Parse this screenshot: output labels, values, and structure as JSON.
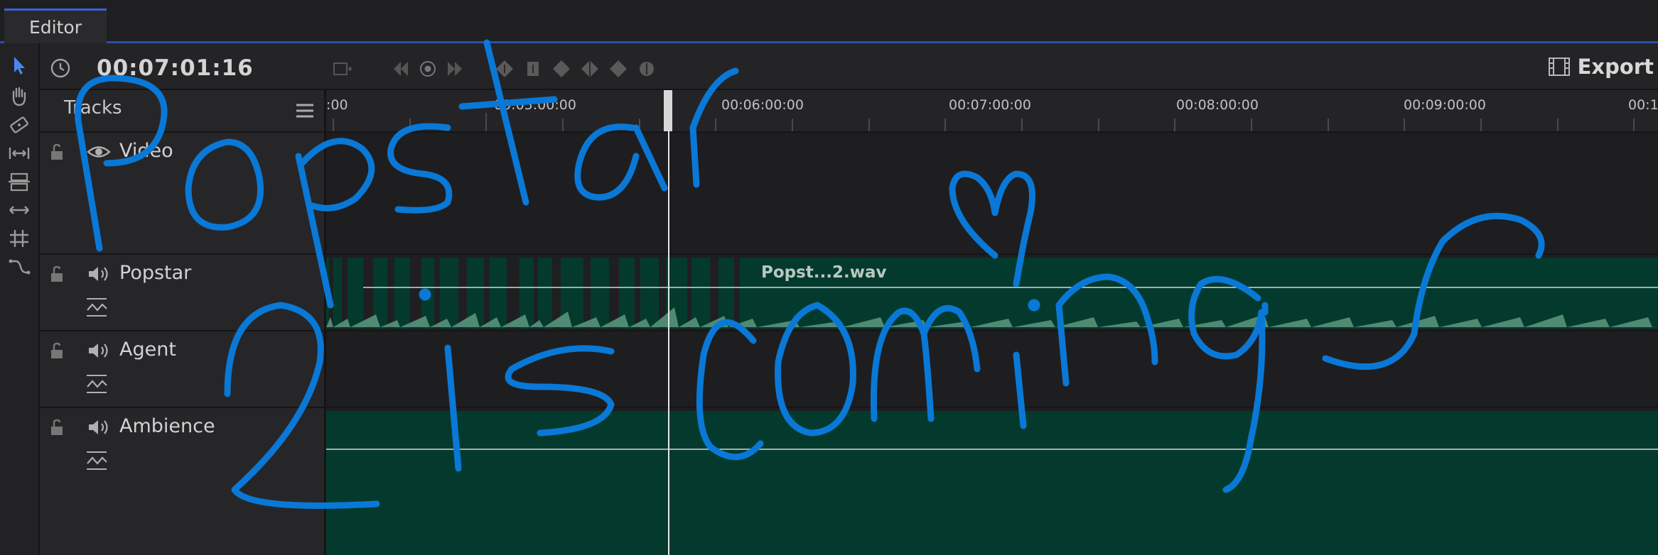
{
  "tabs": [
    {
      "label": "Editor",
      "active": true
    }
  ],
  "tools": [
    "select-arrow-icon",
    "hand-icon",
    "razor-icon",
    "slip-icon",
    "ripple-icon",
    "stretch-icon",
    "roll-icon",
    "curve-icon"
  ],
  "timecode": "00:07:01:16",
  "export_label": "Export",
  "tracks_panel": {
    "title": "Tracks"
  },
  "tracks": [
    {
      "name": "Video",
      "kind": "video"
    },
    {
      "name": "Popstar",
      "kind": "audio"
    },
    {
      "name": "Agent",
      "kind": "audio"
    },
    {
      "name": "Ambience",
      "kind": "audio"
    }
  ],
  "ruler_labels": [
    ":00",
    "00:05:00:00",
    "00:06:00:00",
    "00:07:00:00",
    "00:08:00:00",
    "00:09:00:00",
    "00:1"
  ],
  "clips": [
    {
      "track": "Popstar",
      "name": "Popst...2.wav"
    }
  ],
  "colors": {
    "accent": "#3a62d8",
    "clip": "#043a2d",
    "ink": "#0a78d6"
  }
}
